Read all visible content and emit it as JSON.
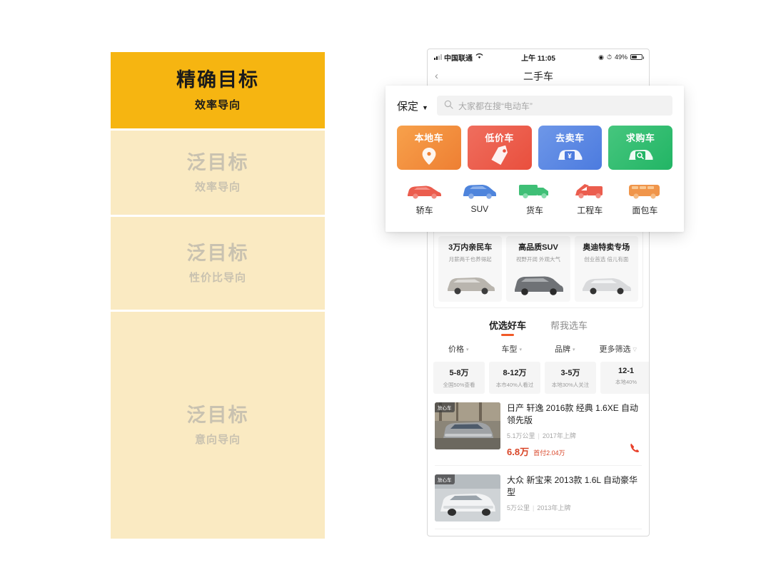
{
  "pyramid": {
    "levels": [
      {
        "title": "精确目标",
        "sub": "效率导向"
      },
      {
        "title": "泛目标",
        "sub": "效率导向"
      },
      {
        "title": "泛目标",
        "sub": "性价比导向"
      },
      {
        "title": "泛目标",
        "sub": "意向导向"
      }
    ],
    "colors": {
      "active": "#F6B511",
      "inactive": "#FAEAC2",
      "active_text": "#1B1B1B",
      "inactive_text": "#C9C2B0"
    }
  },
  "phone": {
    "status_bar": {
      "carrier": "中国联通",
      "time": "上午 11:05",
      "battery_percent": "49%",
      "wifi_icon": "wifi-icon",
      "signal_icon": "signal-bars-icon",
      "location_icon": "location-arrow-icon",
      "alarm_icon": "alarm-clock-icon",
      "battery_icon": "battery-icon"
    },
    "nav": {
      "back_icon": "chevron-left-icon",
      "title": "二手车"
    },
    "promos": [
      {
        "title": "3万内亲民车",
        "sub": "月薪两千也养得起",
        "car_color": "#B9B5AE"
      },
      {
        "title": "高品质SUV",
        "sub": "视野开阔 外观大气",
        "car_color": "#6F7276"
      },
      {
        "title": "奥迪特卖专场",
        "sub": "创业首选 倍儿有面",
        "car_color": "#D9DADC"
      }
    ],
    "tabs": [
      {
        "label": "优选好车",
        "active": true
      },
      {
        "label": "帮我选车",
        "active": false
      }
    ],
    "tab_accent": "#F05A28",
    "filters": [
      {
        "label": "价格"
      },
      {
        "label": "车型"
      },
      {
        "label": "品牌"
      },
      {
        "label": "更多筛选"
      }
    ],
    "price_chips": [
      {
        "title": "5-8万",
        "sub": "全国50%查看"
      },
      {
        "title": "8-12万",
        "sub": "本市40%人看过"
      },
      {
        "title": "3-5万",
        "sub": "本地30%人关注"
      },
      {
        "title": "12-1",
        "sub": "本地40%"
      }
    ],
    "listings": [
      {
        "badge": "放心车",
        "title": "日产 轩逸 2016款 经典 1.6XE 自动领先版",
        "mileage": "5.1万公里",
        "year": "2017年上牌",
        "price": "6.8万",
        "down_payment": "首付2.04万",
        "call_icon": "phone-call-icon",
        "thumb_color": "#7E7B72"
      },
      {
        "badge": "放心车",
        "title": "大众 新宝来 2013款 1.6L 自动豪华型",
        "mileage": "5万公里",
        "year": "2013年上牌",
        "price": "",
        "down_payment": "",
        "call_icon": "phone-call-icon",
        "thumb_color": "#BFC3C6"
      }
    ]
  },
  "overlay": {
    "city": "保定",
    "city_caret": "▼",
    "search": {
      "icon": "search-icon",
      "placeholder": "大家都在搜“电动车”"
    },
    "action_cards": [
      {
        "label": "本地车",
        "icon": "map-pin-icon",
        "theme": "c-orange",
        "color": "#EE7F33"
      },
      {
        "label": "低价车",
        "icon": "price-tag-icon",
        "theme": "c-red",
        "color": "#E94F3D"
      },
      {
        "label": "去卖车",
        "icon": "car-money-icon",
        "theme": "c-blue",
        "color": "#4C7BDF"
      },
      {
        "label": "求购车",
        "icon": "car-search-icon",
        "theme": "c-green",
        "color": "#22B565"
      }
    ],
    "vehicle_types": [
      {
        "label": "轿车",
        "icon": "sedan-icon",
        "color": "#EB5D4E"
      },
      {
        "label": "SUV",
        "icon": "suv-icon",
        "color": "#4E84DC"
      },
      {
        "label": "货车",
        "icon": "truck-icon",
        "color": "#3FBF76"
      },
      {
        "label": "工程车",
        "icon": "tow-truck-icon",
        "color": "#EB5D4E"
      },
      {
        "label": "面包车",
        "icon": "van-icon",
        "color": "#F0954A"
      }
    ]
  }
}
